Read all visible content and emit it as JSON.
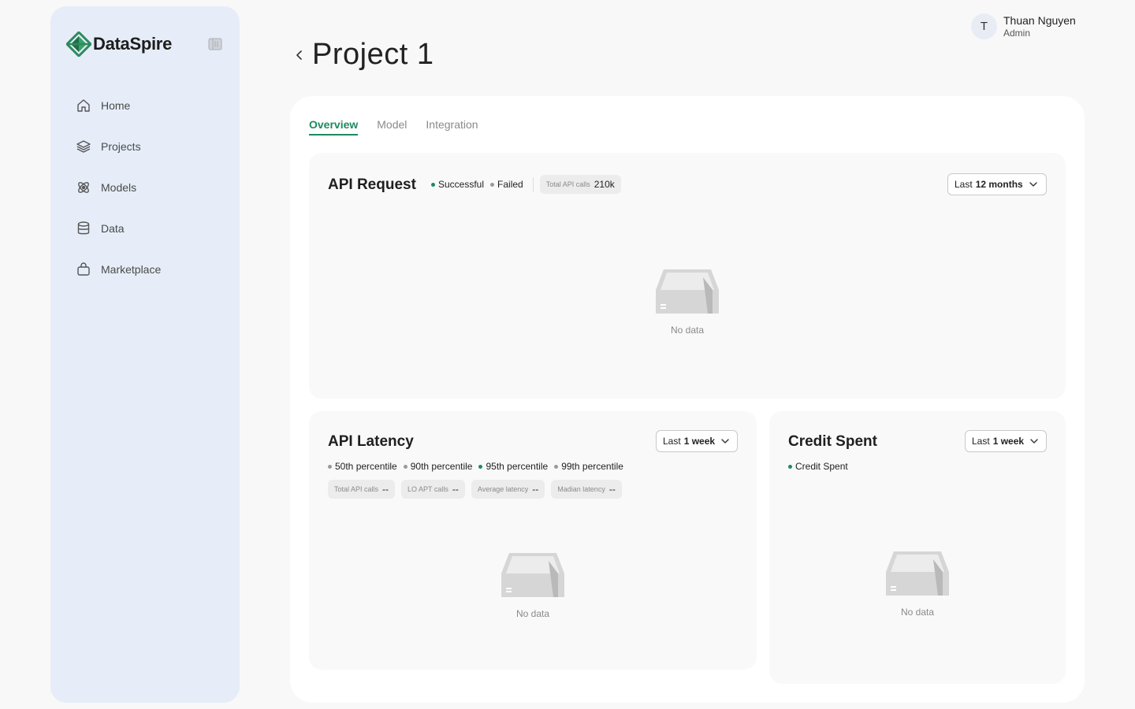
{
  "brand": {
    "name": "DataSpire",
    "accent": "#1d8a5f"
  },
  "sidebar": {
    "items": [
      {
        "label": "Home",
        "icon": "home-icon"
      },
      {
        "label": "Projects",
        "icon": "layers-icon"
      },
      {
        "label": "Models",
        "icon": "atom-icon"
      },
      {
        "label": "Data",
        "icon": "database-icon"
      },
      {
        "label": "Marketplace",
        "icon": "bag-icon"
      }
    ]
  },
  "header": {
    "title": "Project 1"
  },
  "user": {
    "initial": "T",
    "name": "Thuan Nguyen",
    "role": "Admin"
  },
  "tabs": [
    {
      "label": "Overview",
      "active": true
    },
    {
      "label": "Model",
      "active": false
    },
    {
      "label": "Integration",
      "active": false
    }
  ],
  "api_request": {
    "title": "API Request",
    "legend": [
      {
        "label": "Successful",
        "color": "#1d8a5f"
      },
      {
        "label": "Failed",
        "color": "#9a9a9a"
      }
    ],
    "stat": {
      "label": "Total API calls",
      "value": "210k"
    },
    "range": {
      "prefix": "Last",
      "value": "12 months"
    },
    "empty": "No data"
  },
  "api_latency": {
    "title": "API Latency",
    "legend": [
      {
        "label": "50th percentile",
        "color": "#9a9a9a"
      },
      {
        "label": "90th percentile",
        "color": "#9a9a9a"
      },
      {
        "label": "95th percentile",
        "color": "#1d8a5f"
      },
      {
        "label": "99th percentile",
        "color": "#9a9a9a"
      }
    ],
    "stats": [
      {
        "label": "Total API calls",
        "value": "--"
      },
      {
        "label": "LO APT calls",
        "value": "--"
      },
      {
        "label": "Average latency",
        "value": "--"
      },
      {
        "label": "Madian latency",
        "value": "--"
      }
    ],
    "range": {
      "prefix": "Last",
      "value": "1 week"
    },
    "empty": "No data"
  },
  "credit_spent": {
    "title": "Credit Spent",
    "legend": [
      {
        "label": "Credit Spent",
        "color": "#1d8a5f"
      }
    ],
    "range": {
      "prefix": "Last",
      "value": "1 week"
    },
    "empty": "No data"
  }
}
